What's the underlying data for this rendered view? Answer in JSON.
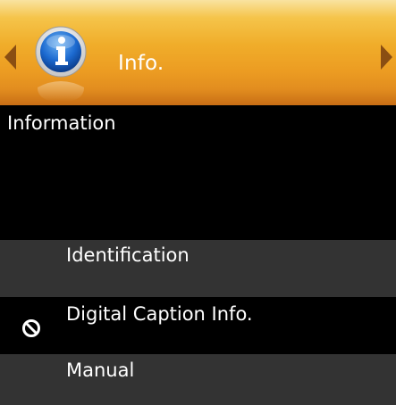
{
  "header": {
    "title": "Info.",
    "icon": "info-icon",
    "left_arrow": "left-arrow-icon",
    "right_arrow": "right-arrow-icon",
    "colors": {
      "gradient_top": "#f9e3a0",
      "gradient_mid": "#f0ad2a",
      "gradient_bottom": "#c86e15",
      "arrow": "#8a4e12"
    }
  },
  "section": {
    "title": "Information"
  },
  "menu": {
    "items": [
      {
        "label": "Identification",
        "icon": ""
      },
      {
        "label": "Digital Caption Info.",
        "icon": "prohibited-icon"
      },
      {
        "label": "Manual",
        "icon": ""
      }
    ]
  },
  "colors": {
    "background": "#000000",
    "row_highlight": "#333333",
    "text": "#ffffff"
  }
}
